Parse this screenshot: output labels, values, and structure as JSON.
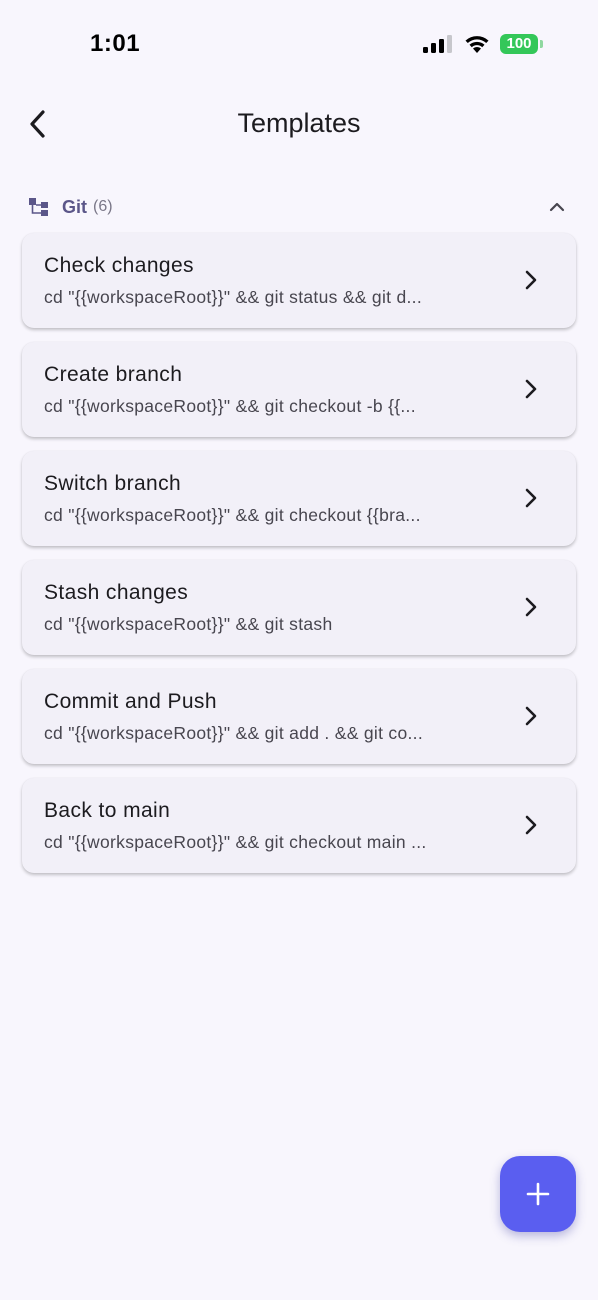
{
  "status_bar": {
    "time": "1:01",
    "battery_level": "100",
    "signal_icon": "cellular-signal-icon",
    "wifi_icon": "wifi-icon",
    "battery_color": "#34c759"
  },
  "app_bar": {
    "back_icon": "chevron-left-icon",
    "title": "Templates"
  },
  "section": {
    "icon": "git-tree-icon",
    "label": "Git",
    "count": "(6)",
    "collapse_icon": "chevron-up-icon",
    "accent_color": "#5b5689"
  },
  "templates": [
    {
      "title": "Check changes",
      "command": "cd \"{{workspaceRoot}}\" && git status && git d...",
      "chevron_icon": "chevron-right-icon"
    },
    {
      "title": "Create branch",
      "command": "cd \"{{workspaceRoot}}\" && git checkout -b {{...",
      "chevron_icon": "chevron-right-icon"
    },
    {
      "title": "Switch branch",
      "command": "cd \"{{workspaceRoot}}\" && git checkout {{bra...",
      "chevron_icon": "chevron-right-icon"
    },
    {
      "title": "Stash changes",
      "command": "cd \"{{workspaceRoot}}\" && git stash",
      "chevron_icon": "chevron-right-icon"
    },
    {
      "title": "Commit and Push",
      "command": "cd \"{{workspaceRoot}}\" && git add . && git co...",
      "chevron_icon": "chevron-right-icon"
    },
    {
      "title": "Back to main",
      "command": "cd \"{{workspaceRoot}}\" && git checkout main ...",
      "chevron_icon": "chevron-right-icon"
    }
  ],
  "fab": {
    "icon": "plus-icon",
    "color": "#5a5ef0"
  }
}
